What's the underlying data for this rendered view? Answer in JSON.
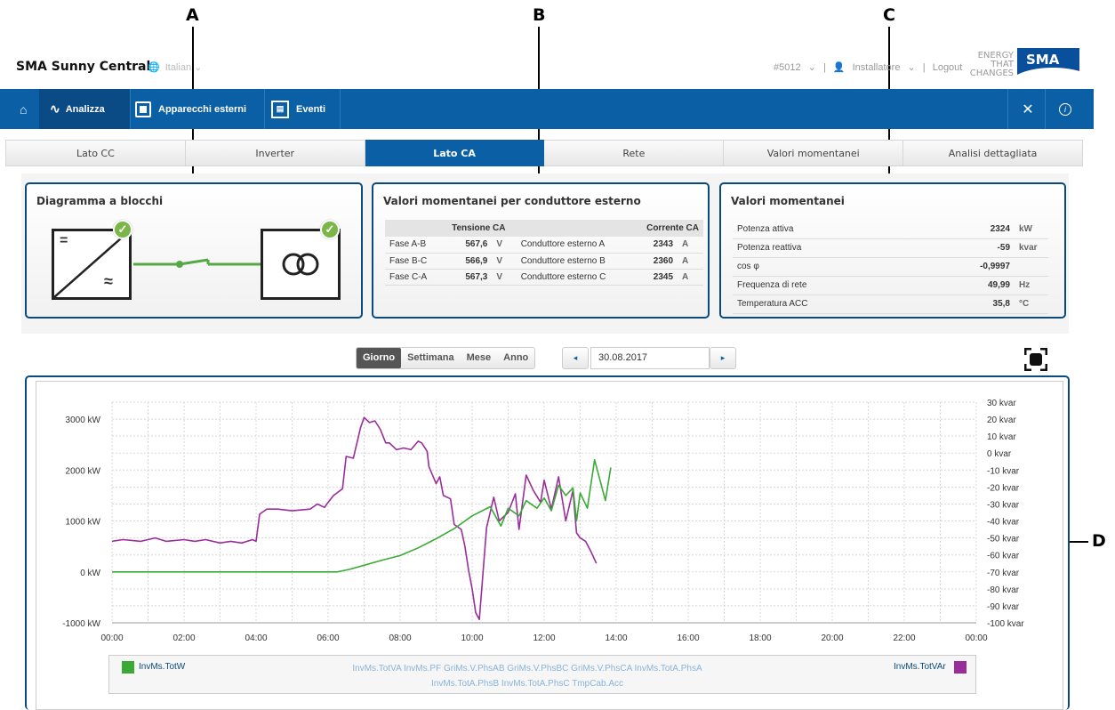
{
  "callouts": {
    "a": "A",
    "b": "B",
    "c": "C",
    "d": "D"
  },
  "header": {
    "app_title": "SMA Sunny Central",
    "language": "Italian",
    "device": "#5012",
    "user": "Installatore",
    "logout": "Logout",
    "logo_tagline": [
      "ENERGY",
      "THAT",
      "CHANGES"
    ],
    "logo": "SMA"
  },
  "nav": {
    "analizza": "Analizza",
    "apparecchi": "Apparecchi esterni",
    "eventi": "Eventi",
    "calendar_glyph": "▤"
  },
  "subtabs": [
    "Lato CC",
    "Inverter",
    "Lato CA",
    "Rete",
    "Valori momentanei",
    "Analisi dettagliata"
  ],
  "block_diagram": {
    "title": "Diagramma a blocchi",
    "inverter_symbols": [
      "=",
      "≈"
    ],
    "transformer_symbol": "ↀ"
  },
  "conductor_values": {
    "title": "Valori momentanei per conduttore esterno",
    "voltage_header": "Tensione CA",
    "current_header": "Corrente CA",
    "rows": [
      {
        "phase": "Fase A-B",
        "voltage": "567,6",
        "v_unit": "V",
        "conductor": "Conduttore esterno A",
        "current": "2343",
        "a_unit": "A"
      },
      {
        "phase": "Fase B-C",
        "voltage": "566,9",
        "v_unit": "V",
        "conductor": "Conduttore esterno B",
        "current": "2360",
        "a_unit": "A"
      },
      {
        "phase": "Fase C-A",
        "voltage": "567,3",
        "v_unit": "V",
        "conductor": "Conduttore esterno C",
        "current": "2345",
        "a_unit": "A"
      }
    ]
  },
  "momentary_values": {
    "title": "Valori momentanei",
    "rows": [
      {
        "label": "Potenza attiva",
        "value": "2324",
        "unit": "kW"
      },
      {
        "label": "Potenza reattiva",
        "value": "-59",
        "unit": "kvar"
      },
      {
        "label": "cos φ",
        "value": "-0,9997",
        "unit": ""
      },
      {
        "label": "Frequenza di rete",
        "value": "49,99",
        "unit": "Hz"
      },
      {
        "label": "Temperatura ACC",
        "value": "35,8",
        "unit": "°C"
      }
    ]
  },
  "controls": {
    "periods": [
      "Giorno",
      "Settimana",
      "Mese",
      "Anno"
    ],
    "active_period": "Giorno",
    "prev": "◂",
    "next": "▸",
    "date": "30.08.2017"
  },
  "legend": {
    "left": "InvMs.TotW",
    "right": "InvMs.TotVAr",
    "inactive_line1": "InvMs.TotVA  InvMs.PF  GriMs.V.PhsAB  GriMs.V.PhsBC  GriMs.V.PhsCA  InvMs.TotA.PhsA",
    "inactive_line2": "InvMs.TotA.PhsB  InvMs.TotA.PhsC  TmpCab.Acc"
  },
  "colors": {
    "brand_blue": "#0b5fa5",
    "panel_border": "#0b4a7c",
    "series_active_power": "#3aaa35",
    "series_reactive_power": "#9b2d9b",
    "check_green": "#7ab648"
  },
  "chart_data": {
    "type": "line",
    "xlabel": "",
    "x_ticks": [
      "00:00",
      "02:00",
      "04:00",
      "06:00",
      "08:00",
      "10:00",
      "12:00",
      "14:00",
      "16:00",
      "18:00",
      "20:00",
      "22:00",
      "00:00"
    ],
    "x_range_hours": [
      0,
      24
    ],
    "y_left": {
      "ticks": [
        "3000 kW",
        "2000 kW",
        "1000 kW",
        "0 kW",
        "-1000 kW"
      ],
      "range": [
        -1000,
        3000
      ],
      "unit": "kW"
    },
    "y_right": {
      "ticks": [
        "30 kvar",
        "20 kvar",
        "10 kvar",
        "0 kvar",
        "-10 kvar",
        "-20 kvar",
        "-30 kvar",
        "-40 kvar",
        "-50 kvar",
        "-60 kvar",
        "-70 kvar",
        "-80 kvar",
        "-90 kvar",
        "-100 kvar"
      ],
      "range": [
        -100,
        30
      ],
      "unit": "kvar"
    },
    "grid": true,
    "series": [
      {
        "name": "InvMs.TotW",
        "axis": "left",
        "points": [
          [
            0,
            0
          ],
          [
            6.25,
            0
          ],
          [
            6.6,
            50
          ],
          [
            7,
            130
          ],
          [
            7.5,
            230
          ],
          [
            8,
            320
          ],
          [
            8.5,
            470
          ],
          [
            9,
            650
          ],
          [
            9.5,
            850
          ],
          [
            10,
            1100
          ],
          [
            10.5,
            1280
          ],
          [
            10.8,
            900
          ],
          [
            11,
            1250
          ],
          [
            11.3,
            1100
          ],
          [
            11.5,
            1400
          ],
          [
            11.8,
            1250
          ],
          [
            12,
            1450
          ],
          [
            12.2,
            1200
          ],
          [
            12.4,
            1700
          ],
          [
            12.6,
            1500
          ],
          [
            12.8,
            1650
          ],
          [
            12.9,
            1000
          ],
          [
            13,
            1550
          ],
          [
            13.2,
            1250
          ],
          [
            13.4,
            2200
          ],
          [
            13.7,
            1400
          ],
          [
            13.85,
            2050
          ]
        ]
      },
      {
        "name": "InvMs.TotVAr",
        "axis": "right",
        "points": [
          [
            0,
            -52
          ],
          [
            0.3,
            -51
          ],
          [
            0.8,
            -52
          ],
          [
            1,
            -51
          ],
          [
            1.2,
            -50
          ],
          [
            1.5,
            -52
          ],
          [
            2,
            -51
          ],
          [
            2.3,
            -52
          ],
          [
            2.6,
            -51
          ],
          [
            3,
            -53
          ],
          [
            3.3,
            -52
          ],
          [
            3.6,
            -53
          ],
          [
            3.9,
            -51
          ],
          [
            4,
            -52
          ],
          [
            4.1,
            -36
          ],
          [
            4.3,
            -33
          ],
          [
            4.6,
            -33
          ],
          [
            5,
            -34
          ],
          [
            5.5,
            -33
          ],
          [
            5.7,
            -30
          ],
          [
            5.9,
            -32
          ],
          [
            6,
            -29
          ],
          [
            6.15,
            -25
          ],
          [
            6.4,
            -21
          ],
          [
            6.5,
            -2
          ],
          [
            6.7,
            -3
          ],
          [
            6.9,
            15
          ],
          [
            7,
            21
          ],
          [
            7.15,
            18
          ],
          [
            7.3,
            19
          ],
          [
            7.45,
            14
          ],
          [
            7.6,
            6
          ],
          [
            7.7,
            6
          ],
          [
            7.9,
            2
          ],
          [
            8.1,
            3
          ],
          [
            8.3,
            2
          ],
          [
            8.5,
            7
          ],
          [
            8.6,
            6
          ],
          [
            8.75,
            1
          ],
          [
            8.8,
            -8
          ],
          [
            9,
            -18
          ],
          [
            9.1,
            -14
          ],
          [
            9.2,
            -25
          ],
          [
            9.4,
            -27
          ],
          [
            9.5,
            -42
          ],
          [
            9.7,
            -45
          ],
          [
            9.8,
            -55
          ],
          [
            9.9,
            -69
          ],
          [
            10,
            -80
          ],
          [
            10.1,
            -94
          ],
          [
            10.2,
            -98
          ],
          [
            10.4,
            -44
          ],
          [
            10.6,
            -26
          ],
          [
            10.75,
            -40
          ],
          [
            11,
            -35
          ],
          [
            11.2,
            -24
          ],
          [
            11.3,
            -45
          ],
          [
            11.5,
            -13
          ],
          [
            11.7,
            -22
          ],
          [
            11.9,
            -29
          ],
          [
            12,
            -16
          ],
          [
            12.2,
            -33
          ],
          [
            12.4,
            -14
          ],
          [
            12.6,
            -40
          ],
          [
            12.8,
            -22
          ],
          [
            12.9,
            -47
          ],
          [
            13,
            -50
          ],
          [
            13.15,
            -52
          ],
          [
            13.3,
            -58
          ],
          [
            13.45,
            -65
          ]
        ]
      }
    ]
  }
}
